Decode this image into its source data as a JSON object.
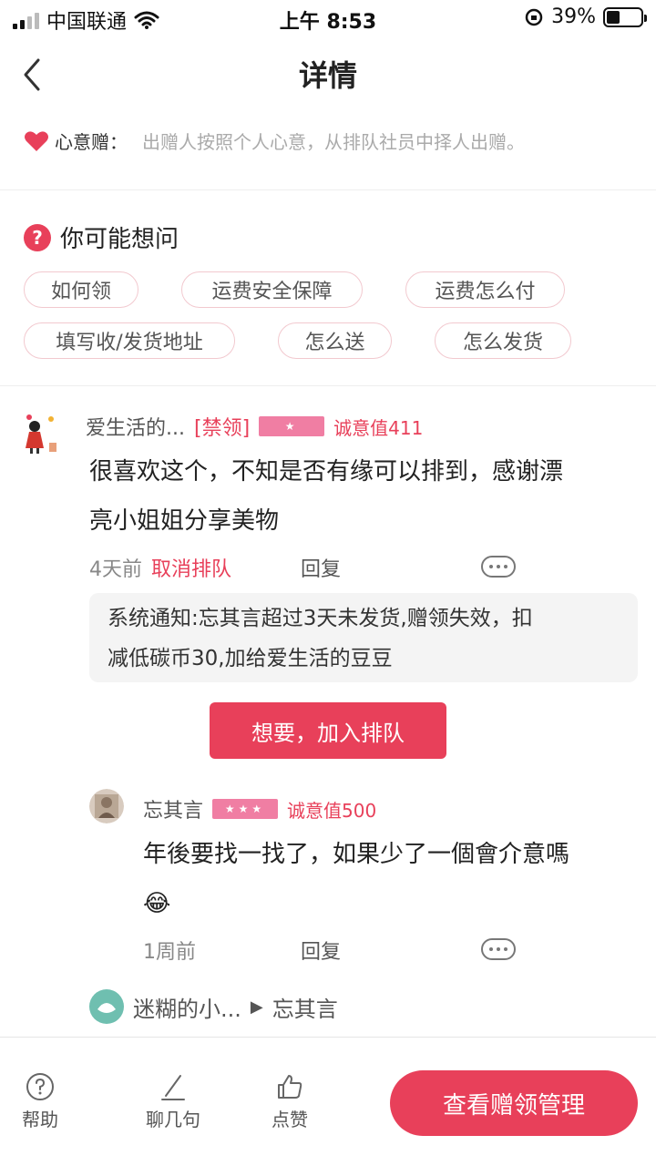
{
  "status_bar": {
    "carrier": "中国联通",
    "time": "上午 8:53",
    "battery": "39%",
    "battery_level": 0.39
  },
  "nav": {
    "title": "详情"
  },
  "intro": {
    "label": "心意赠：",
    "desc": "出赠人按照个人心意，从排队社员中择人出赠。"
  },
  "faq": {
    "title": "你可能想问",
    "chips": [
      "如何领",
      "运费安全保障",
      "运费怎么付",
      "填写收/发货地址",
      "怎么送",
      "怎么发货"
    ]
  },
  "comment1": {
    "name": "爱生活的...",
    "banned": "[禁领]",
    "stars": "★",
    "sincerity": "诚意值411",
    "text_line1": "很喜欢这个，不知是否有缘可以排到，感谢漂",
    "text_line2": "亮小姐姐分享美物",
    "time": "4天前",
    "cancel": "取消排队",
    "reply": "回复"
  },
  "notice": {
    "line1": "系统通知:忘其言超过3天未发货,赠领失效，扣",
    "line2": "减低碳币30,加给爱生活的豆豆"
  },
  "join_button": "想要，加入排队",
  "comment2": {
    "name": "忘其言",
    "stars": "★★★",
    "sincerity": "诚意值500",
    "text_line1": "年後要找一找了，如果少了一個會介意嗎",
    "emoji": "😂",
    "time": "1周前",
    "reply": "回复"
  },
  "thread": {
    "from": "迷糊的小...",
    "arrow": "▶",
    "to": "忘其言"
  },
  "bottom": {
    "help": "帮助",
    "chat": "聊几句",
    "like": "点赞",
    "manage": "查看赠领管理"
  },
  "colors": {
    "accent": "#e8405a",
    "star_badge": "#f07ea3"
  }
}
